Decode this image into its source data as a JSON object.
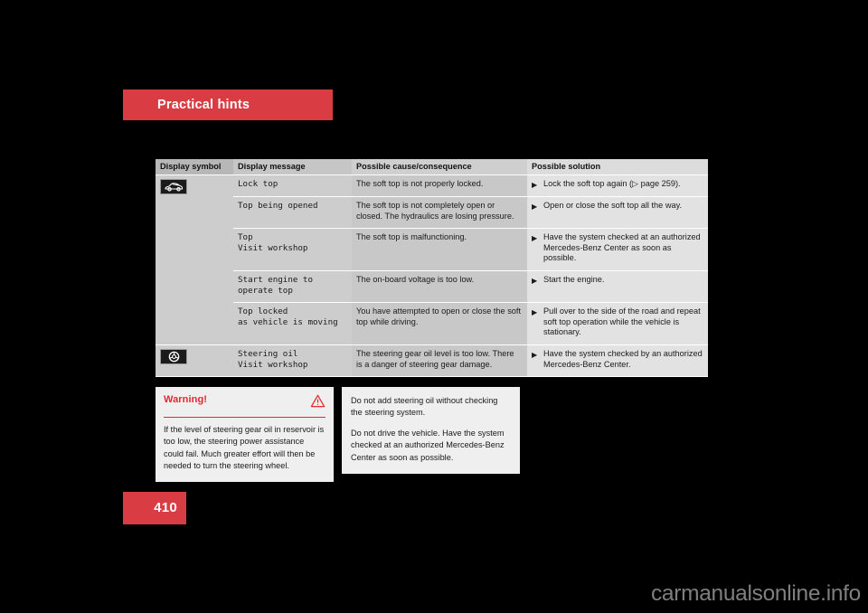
{
  "section": {
    "banner_label": "Practical hints",
    "banner_color": "#da3c43"
  },
  "table": {
    "headers": {
      "symbol": "Display symbol",
      "message": "Display message",
      "cause": "Possible cause/consequence",
      "solution": "Possible solution"
    },
    "rows": [
      {
        "symbol_icon": "convertible-car-icon",
        "message": "Lock top",
        "cause": "The soft top is not properly locked.",
        "solution": "Lock the soft top again (▷ page 259)."
      },
      {
        "symbol_icon": "",
        "message": "Top being opened",
        "cause": "The soft top is not completely open or closed. The hydraulics are losing pressure.",
        "solution": "Open or close the soft top all the way."
      },
      {
        "symbol_icon": "",
        "message": "Top\nVisit workshop",
        "cause": "The soft top is malfunctioning.",
        "solution": "Have the system checked at an authorized Mercedes-Benz Center as soon as possible."
      },
      {
        "symbol_icon": "",
        "message": "Start engine to\noperate top",
        "cause": "The on-board voltage is too low.",
        "solution": "Start the engine."
      },
      {
        "symbol_icon": "",
        "message": "Top locked\nas vehicle is moving",
        "cause": "You have attempted to open or close the soft top while driving.",
        "solution": "Pull over to the side of the road and repeat soft top operation while the vehicle is stationary."
      },
      {
        "symbol_icon": "steering-wheel-icon",
        "message": "Steering oil\nVisit workshop",
        "cause": "The steering gear oil level is too low. There is a danger of steering gear damage.",
        "solution": "Have the system checked by an authorized Mercedes-Benz Center."
      }
    ]
  },
  "warning": {
    "title": "Warning!",
    "icon": "warning-triangle-icon",
    "accent_color": "#e8262d",
    "body": "If the level of steering gear oil in reservoir is too low, the steering power assistance could fail. Much greater effort will then be needed to turn the steering wheel."
  },
  "advice": {
    "paragraph_1": "Do not add steering oil without checking the steering system.",
    "paragraph_2": "Do not drive the vehicle. Have the system checked at an authorized Mercedes-Benz Center as soon as possible."
  },
  "footer": {
    "page_number": "410",
    "watermark": "carmanualsonline.info"
  }
}
